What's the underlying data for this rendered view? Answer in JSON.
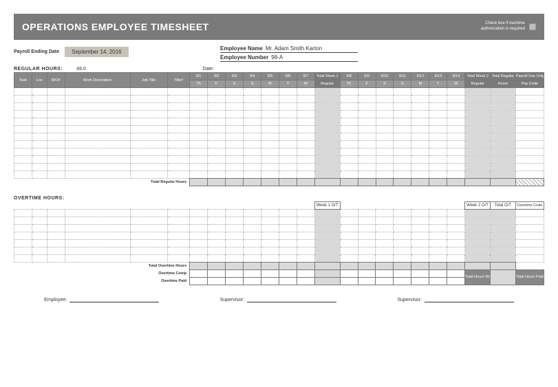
{
  "header": {
    "title": "OPERATIONS EMPLOYEE TIMESHEET",
    "checkbox_note_1": "Check box if overtime",
    "checkbox_note_2": "authorization is required"
  },
  "meta": {
    "payroll_ending_label": "Payroll Ending Date",
    "payroll_ending_value": "September 14, 2016",
    "employee_name_label": "Employee Name",
    "employee_name_value": "Mr. Adam Smith Karton",
    "employee_number_label": "Employee Number",
    "employee_number_value": "98-A",
    "date_label": "Date:",
    "regular_hours_label": "REGULAR HOURS:",
    "regular_hours_value": "48.0",
    "overtime_hours_label": "OVERTIME HOURS:"
  },
  "columns": {
    "left": [
      "Task",
      "Loc",
      "WO#",
      "Work Description",
      "Job Title",
      "Title#"
    ],
    "week1_days_top": [
      "9/1",
      "9/2",
      "9/3",
      "9/4",
      "9/5",
      "9/6",
      "9/7"
    ],
    "week1_days_bot": [
      "Th",
      "F",
      "S",
      "S",
      "M",
      "T",
      "W"
    ],
    "week1_total_top": "Total Week 1",
    "week1_total_bot": "Regular",
    "week2_days_top": [
      "9/8",
      "9/9",
      "9/10",
      "9/11",
      "9/12",
      "9/13",
      "9/14"
    ],
    "week2_days_bot": [
      "Th",
      "F",
      "S",
      "S",
      "M",
      "T",
      "W"
    ],
    "week2_total_top": "Total Week 2",
    "week2_total_bot": "Regular",
    "total_reg_top": "Total Regular",
    "total_reg_bot": "Hours",
    "payroll_top": "Payroll Use Only",
    "payroll_bot": "Pay Code"
  },
  "ot_columns": {
    "week1_ot": "Week 1 O/T",
    "week2_ot": "Week 2 O/T",
    "total_ot": "Total O/T",
    "ot_code": "Overtime Code"
  },
  "totals": {
    "total_regular_hours": "Total Regular Hours",
    "total_overtime_hours": "Total Overtime Hours",
    "overtime_comp": "Overtime Comp",
    "overtime_paid": "Overtime Paid",
    "total_hours_worked": "Total Hours Worked",
    "total_hours_paid": "Total Hours Paid"
  },
  "signatures": {
    "employee": "Employee:",
    "supervisor": "Supervisor:",
    "supervisor2": "Supervisor:"
  }
}
